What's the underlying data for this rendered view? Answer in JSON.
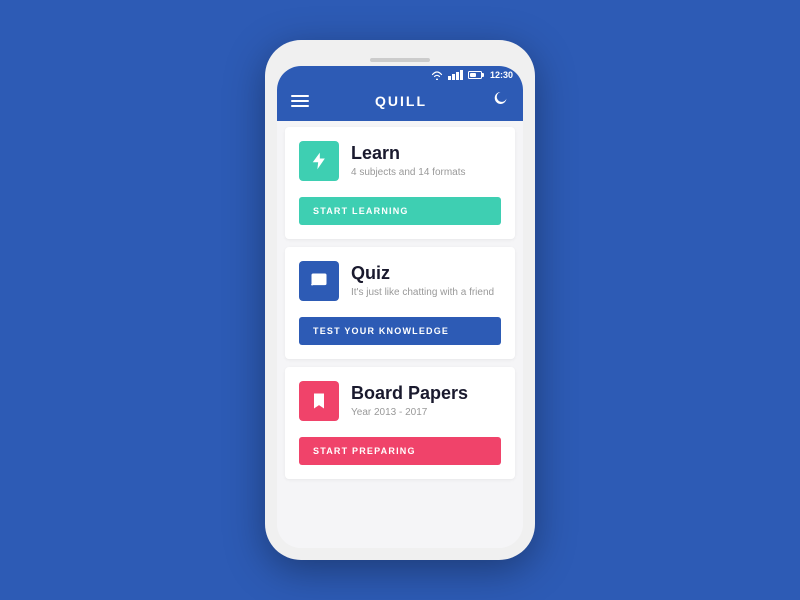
{
  "background": "#2d5bb5",
  "phone": {
    "statusBar": {
      "time": "12:30"
    },
    "header": {
      "title": "QUILL",
      "menuIcon": "hamburger-icon",
      "profileIcon": "profile-icon"
    },
    "cards": [
      {
        "id": "learn",
        "title": "Learn",
        "subtitle": "4 subjects and 14 formats",
        "iconColor": "teal",
        "actionLabel": "START LEARNING",
        "actionColor": "teal"
      },
      {
        "id": "quiz",
        "title": "Quiz",
        "subtitle": "It's just like chatting with a friend",
        "iconColor": "navy",
        "actionLabel": "TEST YOUR KNOWLEDGE",
        "actionColor": "navy"
      },
      {
        "id": "board-papers",
        "title": "Board Papers",
        "subtitle": "Year 2013 - 2017",
        "iconColor": "pink",
        "actionLabel": "START PREPARING",
        "actionColor": "pink"
      }
    ]
  }
}
